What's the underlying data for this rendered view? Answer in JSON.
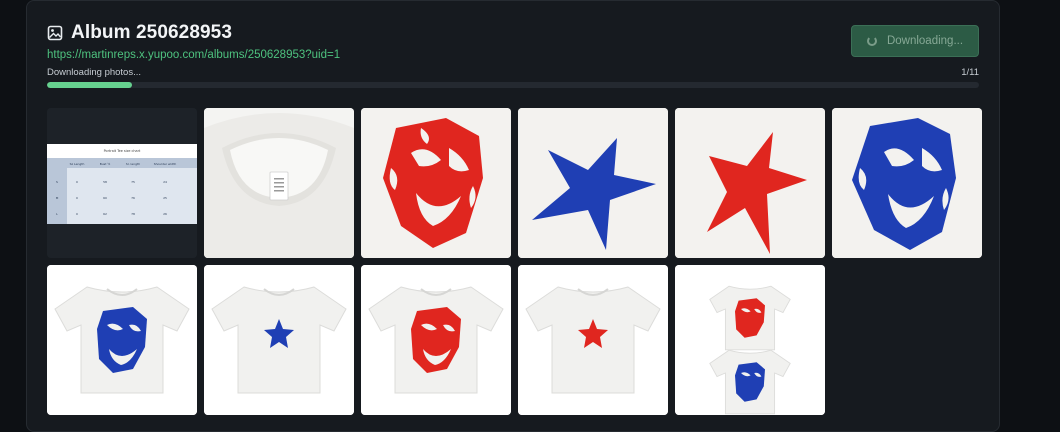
{
  "album": {
    "title": "Album 250628953",
    "url": "https://martinreps.x.yupoo.com/albums/250628953?uid=1"
  },
  "download_button": {
    "label": "Downloading..."
  },
  "progress": {
    "status": "Downloading photos...",
    "count": "1/11",
    "fraction": 0.0909
  },
  "size_chart": {
    "title": "Portrait Tee size chart",
    "headers": [
      "",
      "Sz Length",
      "Bust ½",
      "Sl. length",
      "Shoulder width"
    ],
    "rows": [
      [
        "S",
        "0",
        "58",
        "75",
        "24"
      ],
      [
        "M",
        "0",
        "60",
        "76",
        "25"
      ],
      [
        "L",
        "0",
        "62",
        "78",
        "26"
      ]
    ]
  },
  "colors": {
    "accent": "#4ec27f",
    "progress": "#66d18f",
    "button_bg": "#2c5b45",
    "red_print": "#e0261f",
    "blue_print": "#1f3fb4"
  },
  "photos": [
    {
      "icon": "size-chart"
    },
    {
      "icon": "tshirt-collar-label"
    },
    {
      "icon": "red-mask-print"
    },
    {
      "icon": "blue-star-print"
    },
    {
      "icon": "red-star-print"
    },
    {
      "icon": "blue-mask-print"
    },
    {
      "icon": "blue-mask-tshirt"
    },
    {
      "icon": "blue-star-tshirt"
    },
    {
      "icon": "red-mask-tshirt"
    },
    {
      "icon": "red-star-tshirt"
    },
    {
      "icon": "two-tshirts"
    }
  ]
}
